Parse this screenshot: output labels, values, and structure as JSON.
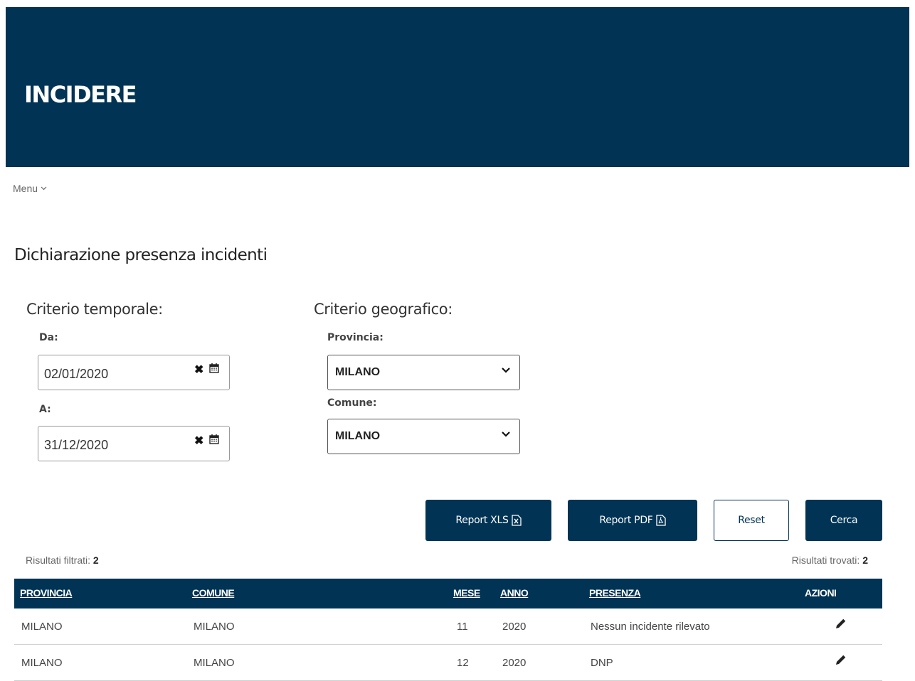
{
  "header": {
    "title": "INCIDERE"
  },
  "menu": {
    "label": "Menu"
  },
  "page": {
    "title": "Dichiarazione presenza incidenti"
  },
  "filters": {
    "temporal": {
      "title": "Criterio temporale:",
      "from_label": "Da:",
      "from_value": "02/01/2020",
      "to_label": "A:",
      "to_value": "31/12/2020"
    },
    "geographic": {
      "title": "Criterio geografico:",
      "province_label": "Provincia:",
      "province_value": "MILANO",
      "comune_label": "Comune:",
      "comune_value": "MILANO"
    }
  },
  "actions": {
    "report_xls": "Report XLS",
    "report_pdf": "Report PDF",
    "reset": "Reset",
    "search": "Cerca"
  },
  "results": {
    "filtered_label": "Risultati filtrati:",
    "filtered_count": "2",
    "found_label": "Risultati trovati:",
    "found_count": "2"
  },
  "table": {
    "headers": {
      "provincia": "PROVINCIA",
      "comune": "COMUNE",
      "mese": "MESE",
      "anno": "ANNO",
      "presenza": "PRESENZA",
      "azioni": "AZIONI"
    },
    "rows": [
      {
        "provincia": "MILANO",
        "comune": "MILANO",
        "mese": "11",
        "anno": "2020",
        "presenza": "Nessun incidente rilevato",
        "action_icon": "pencil-icon"
      },
      {
        "provincia": "MILANO",
        "comune": "MILANO",
        "mese": "12",
        "anno": "2020",
        "presenza": "DNP",
        "action_icon": "pencil-icon"
      }
    ]
  },
  "colors": {
    "brand": "#003354",
    "row_divider": "#cfcfcf"
  }
}
